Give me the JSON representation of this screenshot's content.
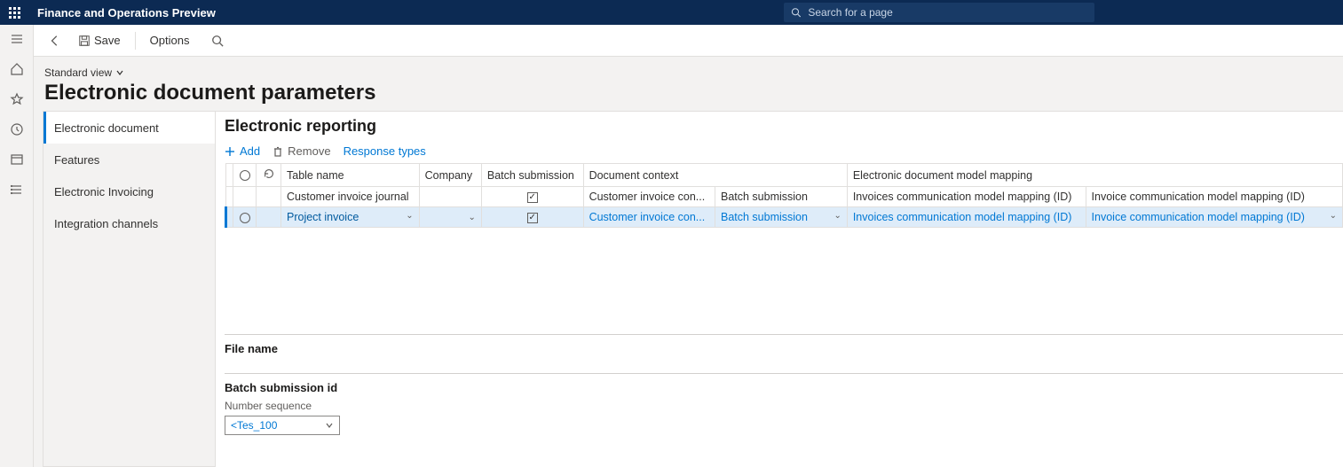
{
  "app_title": "Finance and Operations Preview",
  "search_placeholder": "Search for a page",
  "actionbar": {
    "save": "Save",
    "options": "Options"
  },
  "page": {
    "view_name": "Standard view",
    "title": "Electronic document parameters"
  },
  "side_nav": [
    {
      "label": "Electronic document",
      "active": true
    },
    {
      "label": "Features",
      "active": false
    },
    {
      "label": "Electronic Invoicing",
      "active": false
    },
    {
      "label": "Integration channels",
      "active": false
    }
  ],
  "section_title": "Electronic reporting",
  "toolbar": {
    "add": "Add",
    "remove": "Remove",
    "response_types": "Response types"
  },
  "grid": {
    "columns": [
      "Table name",
      "Company",
      "Batch submission",
      "Document context",
      "",
      "Electronic document model mapping",
      ""
    ],
    "rows": [
      {
        "selected": false,
        "table_name": "Customer invoice journal",
        "company": "",
        "batch_submission": true,
        "doc_context_1": "Customer invoice con...",
        "doc_context_2": "Batch submission",
        "mapping_1": "Invoices communication model mapping (ID)",
        "mapping_2": "Invoice communication model mapping (ID)"
      },
      {
        "selected": true,
        "table_name": "Project invoice",
        "company": "",
        "batch_submission": true,
        "doc_context_1": "Customer invoice con...",
        "doc_context_2": "Batch submission",
        "mapping_1": "Invoices communication model mapping (ID)",
        "mapping_2": "Invoice communication model mapping (ID)"
      }
    ]
  },
  "subsections": {
    "file_name": "File name",
    "batch_submission_id": "Batch submission id",
    "number_sequence_label": "Number sequence",
    "number_sequence_value": "<Tes_100"
  }
}
